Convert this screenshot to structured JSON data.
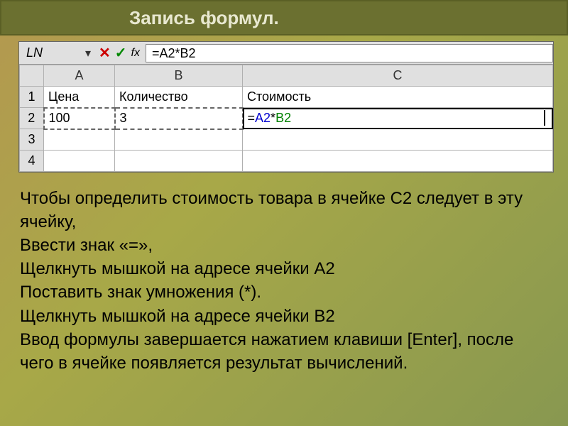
{
  "title": "Запись формул.",
  "excel": {
    "name_box": "LN",
    "formula_bar": "=A2*B2",
    "columns": [
      "A",
      "B",
      "C"
    ],
    "rows": [
      "1",
      "2",
      "3",
      "4"
    ],
    "r1": {
      "a": "Цена",
      "b": "Количество",
      "c": "Стоимость"
    },
    "r2": {
      "a": "100",
      "b": "3",
      "c_prefix": "=",
      "c_a": "A2",
      "c_op": "*",
      "c_b": "B2"
    }
  },
  "instructions": {
    "l1": "Чтобы определить стоимость товара в ячейке С2 следует в эту ячейку,",
    "l2": "Ввести знак «=»,",
    "l3": "Щелкнуть мышкой на адресе ячейки А2",
    "l4": "Поставить знак умножения (*).",
    "l5": "Щелкнуть мышкой на адресе ячейки В2",
    "l6": "Ввод формулы завершается нажатием клавиши [Enter], после чего в ячейке появляется результат вычислений."
  }
}
